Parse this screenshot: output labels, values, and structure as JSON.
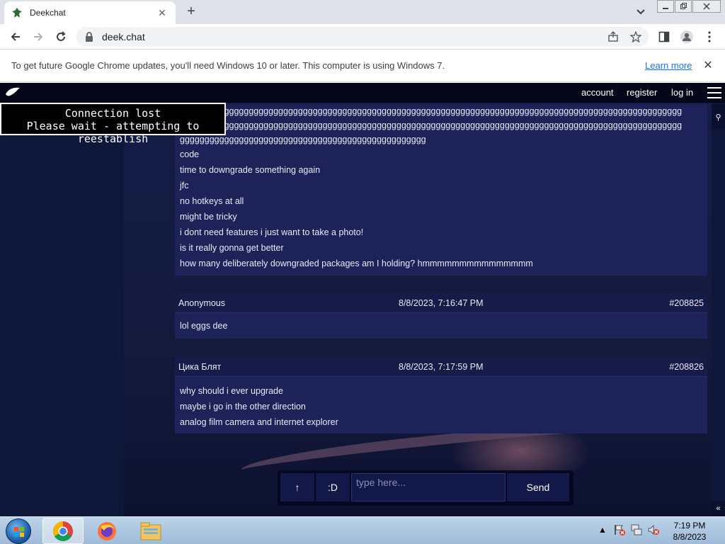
{
  "browser": {
    "tab_title": "Deekchat",
    "tab_close": "✕",
    "new_tab": "+",
    "url": "deek.chat",
    "infobar_message": "To get future Google Chrome updates, you'll need Windows 10 or later. This computer is using Windows 7.",
    "infobar_link": "Learn more",
    "infobar_close": "✕"
  },
  "site": {
    "nav": {
      "account": "account",
      "register": "register",
      "login": "log in"
    },
    "connection": {
      "line1": "Connection lost",
      "line2": "Please wait - attempting to reestablish"
    },
    "search_btn": "⚲",
    "collapse_btn": "«"
  },
  "messages": {
    "first_block": {
      "lines": [
        "gggggggggggggggggggggggggggggggggggggggggggggggggggggggggggggggggggggggggggggggggggggggggggggggggggggg",
        "gggggggggggggggggggggggggggggggggggggggggggggggggggggggggggggggggggggggggggggggggggggggggggggggggggggg",
        "gggggggggggggggggggggggggggggggggggggggggggggggggg",
        "code",
        "time to downgrade something again",
        "jfc",
        "no hotkeys at all",
        "might be tricky",
        "i dont need features i just want to take a photo!",
        "is it really gonna get better",
        "how many deliberately downgraded packages am I holding? hmmmmmmmmmmmmmmm"
      ]
    },
    "posts": [
      {
        "author": "Anonymous",
        "time": "8/8/2023, 7:16:47 PM",
        "id": "#208825",
        "lines": [
          "lol eggs dee"
        ]
      },
      {
        "author": "Цика Блят",
        "time": "8/8/2023, 7:17:59 PM",
        "id": "#208826",
        "lines": [
          "why should i ever upgrade",
          "maybe i go in the other direction",
          "analog film camera and internet explorer"
        ]
      }
    ]
  },
  "composer": {
    "up_label": "↑",
    "emoji_label": ":D",
    "placeholder": "type here...",
    "send_label": "Send"
  },
  "taskbar": {
    "time": "7:19 PM",
    "date": "8/8/2023",
    "tray_arrow": "▲"
  }
}
